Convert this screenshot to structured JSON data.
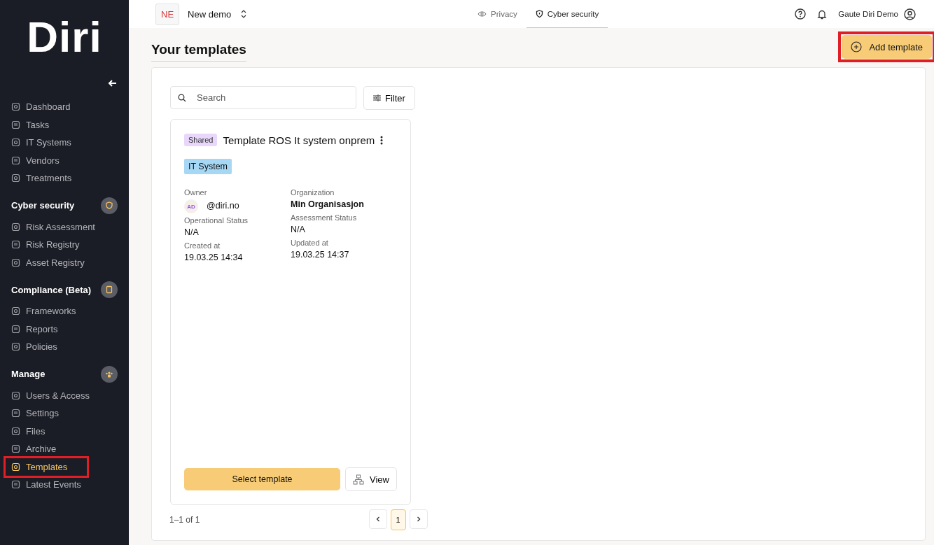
{
  "sidebar": {
    "logo": "Diri",
    "groups": [
      {
        "items": [
          {
            "label": "Dashboard",
            "selected": false,
            "highlighted": false
          },
          {
            "label": "Tasks",
            "selected": false,
            "highlighted": false
          },
          {
            "label": "IT Systems",
            "selected": false,
            "highlighted": false
          },
          {
            "label": "Vendors",
            "selected": false,
            "highlighted": false
          },
          {
            "label": "Treatments",
            "selected": false,
            "highlighted": false
          }
        ]
      },
      {
        "title": "Cyber security",
        "items": [
          {
            "label": "Risk Assessment",
            "selected": false,
            "highlighted": false
          },
          {
            "label": "Risk Registry",
            "selected": false,
            "highlighted": false
          },
          {
            "label": "Asset Registry",
            "selected": false,
            "highlighted": false
          }
        ]
      },
      {
        "title": "Compliance (Beta)",
        "items": [
          {
            "label": "Frameworks",
            "selected": false,
            "highlighted": false
          },
          {
            "label": "Reports",
            "selected": false,
            "highlighted": false
          },
          {
            "label": "Policies",
            "selected": false,
            "highlighted": false
          }
        ]
      },
      {
        "title": "Manage",
        "items": [
          {
            "label": "Users & Access",
            "selected": false,
            "highlighted": false
          },
          {
            "label": "Settings",
            "selected": false,
            "highlighted": false
          },
          {
            "label": "Files",
            "selected": false,
            "highlighted": false
          },
          {
            "label": "Archive",
            "selected": false,
            "highlighted": false
          },
          {
            "label": "Templates",
            "selected": true,
            "highlighted": true
          },
          {
            "label": "Latest Events",
            "selected": false,
            "highlighted": false
          }
        ]
      }
    ]
  },
  "topbar": {
    "org_badge": "NE",
    "org_name": "New demo",
    "tabs": [
      {
        "label": "Privacy",
        "selected": false
      },
      {
        "label": "Cyber security",
        "selected": true
      }
    ],
    "user": "Gaute Diri Demo"
  },
  "page": {
    "title": "Your templates",
    "add_button": {
      "label": "Add template",
      "highlighted": true
    }
  },
  "search": {
    "placeholder": "Search"
  },
  "filter_button": "Filter",
  "cards": [
    {
      "badge": "Shared",
      "title": "Template ROS It system onprem",
      "tag": "IT System",
      "owner": {
        "label": "Owner",
        "initials": "AD",
        "value": "@diri.no"
      },
      "left_fields": [
        {
          "label": "Operational Status",
          "value": "N/A"
        },
        {
          "label": "Created at",
          "value": "19.03.25 14:34"
        }
      ],
      "right_fields": [
        {
          "label": "Organization",
          "value": "Min Organisasjon"
        },
        {
          "label": "Assessment Status",
          "value": "N/A"
        },
        {
          "label": "Updated at",
          "value": "19.03.25 14:37"
        }
      ],
      "select_button": "Select template",
      "view_button": "View"
    }
  ],
  "pagination": {
    "summary": "1–1 of 1",
    "pages": [
      {
        "label": "1",
        "selected": true
      }
    ]
  }
}
